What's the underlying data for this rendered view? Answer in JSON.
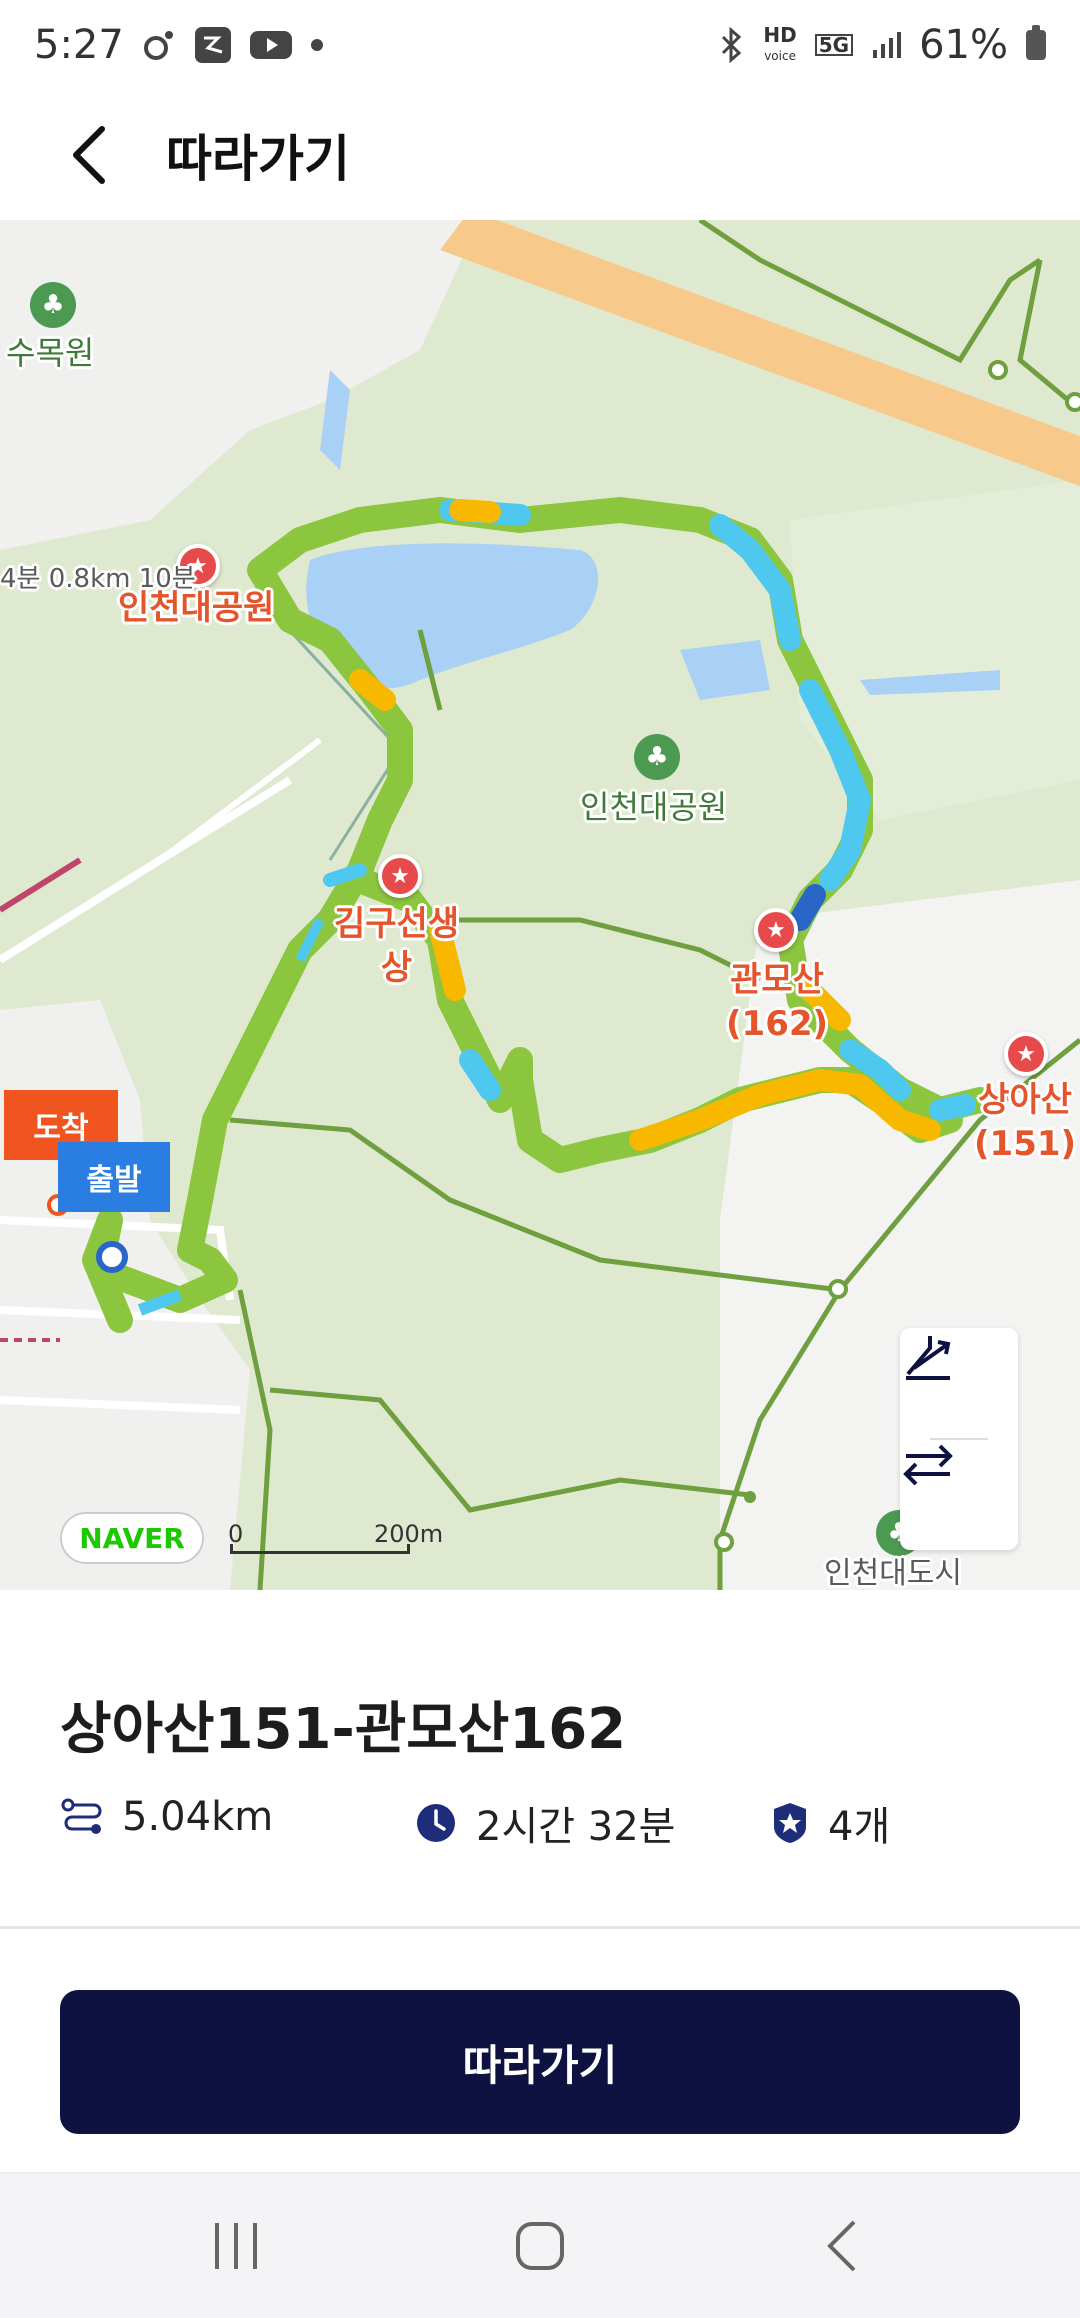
{
  "status_bar": {
    "time": "5:27",
    "hd_label": "HD",
    "voice_label": "voice",
    "network_label": "5G",
    "battery": "61%"
  },
  "header": {
    "title": "따라가기",
    "back_icon": "chevron-left-icon"
  },
  "map": {
    "labels": {
      "arboretum": "수목원",
      "incheon_park_pin": "인천대공원",
      "incheon_park_center": "인천대공원",
      "kimgu_statue_line1": "김구선생",
      "kimgu_statue_line2": "상",
      "gwanmosan_name": "관모산",
      "gwanmosan_height": "(162)",
      "sangasan_name": "상아산",
      "sangasan_height": "(151)",
      "incheon_city": "인천대도시",
      "distance_hint": "4분 0.8km 10분"
    },
    "flags": {
      "arrive": "도착",
      "depart": "출발"
    },
    "naver_logo": "NAVER",
    "scale": {
      "zero": "0",
      "distance": "200m"
    },
    "controls": {
      "elevation_icon": "elevation-chart-icon",
      "reverse_icon": "swap-direction-icon"
    },
    "colors": {
      "route_green": "#8cc63f",
      "route_blue": "#4fc8f0",
      "route_orange": "#f8b800",
      "trail_line": "#6f9f3f",
      "water": "#a9d0f5",
      "highway": "#f7c98a"
    }
  },
  "course": {
    "title": "상아산151-관모산162",
    "distance": "5.04km",
    "duration": "2시간 32분",
    "badge_count": "4개"
  },
  "actions": {
    "follow_label": "따라가기"
  }
}
